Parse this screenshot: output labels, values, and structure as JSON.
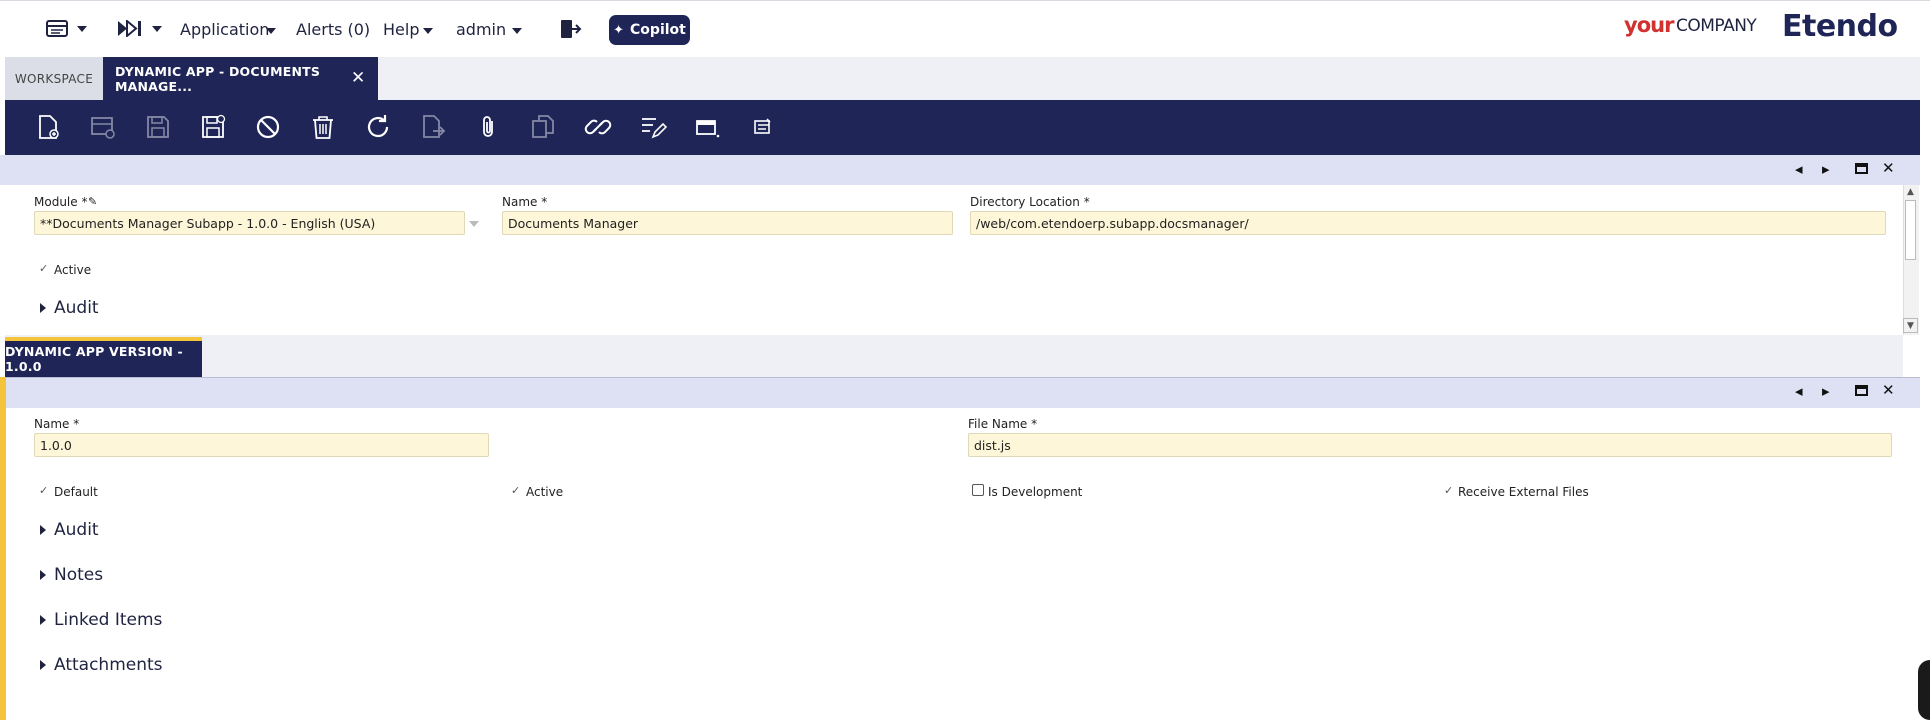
{
  "menu": {
    "application": "Application",
    "alerts": "Alerts (0)",
    "help": "Help",
    "user": "admin",
    "copilot": "Copilot"
  },
  "brand": {
    "your": "your",
    "company": "COMPANY",
    "etendo": "Etendo"
  },
  "tabs": [
    {
      "label": "WORKSPACE"
    },
    {
      "label": "DYNAMIC APP - DOCUMENTS MANAGE..."
    }
  ],
  "toolbar_icons": [
    "new-document-icon",
    "new-row-icon",
    "save-icon",
    "save-close-icon",
    "undo-icon",
    "delete-icon",
    "refresh-icon",
    "export-icon",
    "attachment-icon",
    "clone-icon",
    "link-icon",
    "filter-edit-icon",
    "grid-view-icon",
    "form-view-icon"
  ],
  "header_form": {
    "module_label": "Module *",
    "module_value": "**Documents Manager Subapp - 1.0.0 - English (USA)",
    "name_label": "Name *",
    "name_value": "Documents Manager",
    "dir_label": "Directory Location *",
    "dir_value": "/web/com.etendoerp.subapp.docsmanager/",
    "active_label": "Active",
    "audit_label": "Audit"
  },
  "subtab": {
    "label": "DYNAMIC APP VERSION - 1.0.0"
  },
  "version_form": {
    "name_label": "Name *",
    "name_value": "1.0.0",
    "file_label": "File Name *",
    "file_value": "dist.js",
    "default_label": "Default",
    "active_label": "Active",
    "isdev_label": "Is Development",
    "receive_label": "Receive External Files",
    "sections": [
      "Audit",
      "Notes",
      "Linked Items",
      "Attachments"
    ]
  },
  "colors": {
    "navy": "#1f2657",
    "band": "#dee0f4",
    "field": "#fdf6d9",
    "accent": "#f4c53b",
    "brand_red": "#d1312f"
  }
}
